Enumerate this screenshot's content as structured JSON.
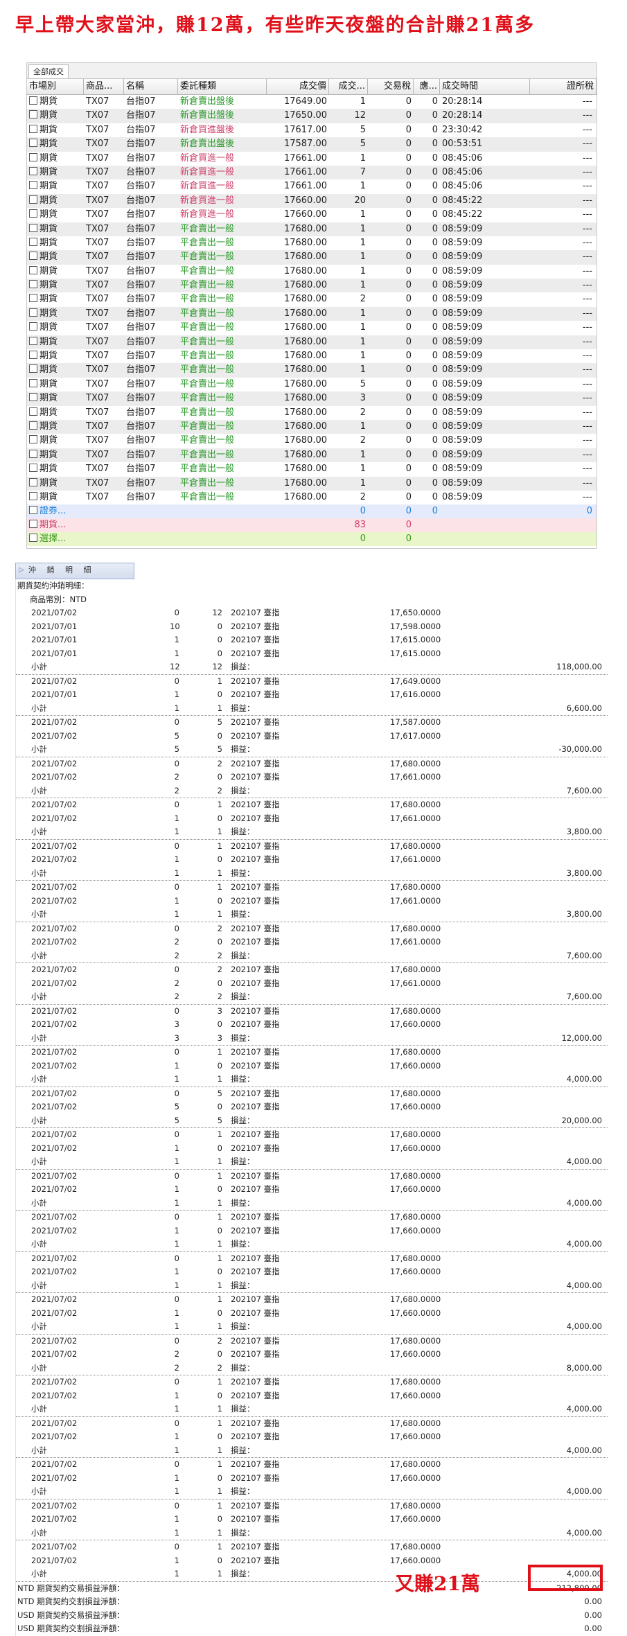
{
  "headline": "早上帶大家當沖，賺12萬，有些昨天夜盤的合計賺21萬多",
  "trades": {
    "tab_label": "全部成交",
    "columns": [
      "市場別",
      "商品...",
      "名稱",
      "委託種類",
      "成交價",
      "成交...",
      "交易稅",
      "應...",
      "成交時間",
      "證所稅"
    ],
    "rows": [
      {
        "market": "期貨",
        "code": "TX07",
        "name": "台指07",
        "type": "新倉賣出盤後",
        "price": "17649.00",
        "qty": "1",
        "tax": "0",
        "fee": "0",
        "time": "20:28:14",
        "stt": "---",
        "tone": "green"
      },
      {
        "market": "期貨",
        "code": "TX07",
        "name": "台指07",
        "type": "新倉賣出盤後",
        "price": "17650.00",
        "qty": "12",
        "tax": "0",
        "fee": "0",
        "time": "20:28:14",
        "stt": "---",
        "tone": "green"
      },
      {
        "market": "期貨",
        "code": "TX07",
        "name": "台指07",
        "type": "新倉買進盤後",
        "price": "17617.00",
        "qty": "5",
        "tax": "0",
        "fee": "0",
        "time": "23:30:42",
        "stt": "---",
        "tone": "red"
      },
      {
        "market": "期貨",
        "code": "TX07",
        "name": "台指07",
        "type": "新倉賣出盤後",
        "price": "17587.00",
        "qty": "5",
        "tax": "0",
        "fee": "0",
        "time": "00:53:51",
        "stt": "---",
        "tone": "green"
      },
      {
        "market": "期貨",
        "code": "TX07",
        "name": "台指07",
        "type": "新倉買進一般",
        "price": "17661.00",
        "qty": "1",
        "tax": "0",
        "fee": "0",
        "time": "08:45:06",
        "stt": "---",
        "tone": "red"
      },
      {
        "market": "期貨",
        "code": "TX07",
        "name": "台指07",
        "type": "新倉買進一般",
        "price": "17661.00",
        "qty": "7",
        "tax": "0",
        "fee": "0",
        "time": "08:45:06",
        "stt": "---",
        "tone": "red"
      },
      {
        "market": "期貨",
        "code": "TX07",
        "name": "台指07",
        "type": "新倉買進一般",
        "price": "17661.00",
        "qty": "1",
        "tax": "0",
        "fee": "0",
        "time": "08:45:06",
        "stt": "---",
        "tone": "red"
      },
      {
        "market": "期貨",
        "code": "TX07",
        "name": "台指07",
        "type": "新倉買進一般",
        "price": "17660.00",
        "qty": "20",
        "tax": "0",
        "fee": "0",
        "time": "08:45:22",
        "stt": "---",
        "tone": "red"
      },
      {
        "market": "期貨",
        "code": "TX07",
        "name": "台指07",
        "type": "新倉買進一般",
        "price": "17660.00",
        "qty": "1",
        "tax": "0",
        "fee": "0",
        "time": "08:45:22",
        "stt": "---",
        "tone": "red"
      },
      {
        "market": "期貨",
        "code": "TX07",
        "name": "台指07",
        "type": "平倉賣出一般",
        "price": "17680.00",
        "qty": "1",
        "tax": "0",
        "fee": "0",
        "time": "08:59:09",
        "stt": "---",
        "tone": "green"
      },
      {
        "market": "期貨",
        "code": "TX07",
        "name": "台指07",
        "type": "平倉賣出一般",
        "price": "17680.00",
        "qty": "1",
        "tax": "0",
        "fee": "0",
        "time": "08:59:09",
        "stt": "---",
        "tone": "green"
      },
      {
        "market": "期貨",
        "code": "TX07",
        "name": "台指07",
        "type": "平倉賣出一般",
        "price": "17680.00",
        "qty": "1",
        "tax": "0",
        "fee": "0",
        "time": "08:59:09",
        "stt": "---",
        "tone": "green"
      },
      {
        "market": "期貨",
        "code": "TX07",
        "name": "台指07",
        "type": "平倉賣出一般",
        "price": "17680.00",
        "qty": "1",
        "tax": "0",
        "fee": "0",
        "time": "08:59:09",
        "stt": "---",
        "tone": "green"
      },
      {
        "market": "期貨",
        "code": "TX07",
        "name": "台指07",
        "type": "平倉賣出一般",
        "price": "17680.00",
        "qty": "1",
        "tax": "0",
        "fee": "0",
        "time": "08:59:09",
        "stt": "---",
        "tone": "green"
      },
      {
        "market": "期貨",
        "code": "TX07",
        "name": "台指07",
        "type": "平倉賣出一般",
        "price": "17680.00",
        "qty": "2",
        "tax": "0",
        "fee": "0",
        "time": "08:59:09",
        "stt": "---",
        "tone": "green"
      },
      {
        "market": "期貨",
        "code": "TX07",
        "name": "台指07",
        "type": "平倉賣出一般",
        "price": "17680.00",
        "qty": "1",
        "tax": "0",
        "fee": "0",
        "time": "08:59:09",
        "stt": "---",
        "tone": "green"
      },
      {
        "market": "期貨",
        "code": "TX07",
        "name": "台指07",
        "type": "平倉賣出一般",
        "price": "17680.00",
        "qty": "1",
        "tax": "0",
        "fee": "0",
        "time": "08:59:09",
        "stt": "---",
        "tone": "green"
      },
      {
        "market": "期貨",
        "code": "TX07",
        "name": "台指07",
        "type": "平倉賣出一般",
        "price": "17680.00",
        "qty": "1",
        "tax": "0",
        "fee": "0",
        "time": "08:59:09",
        "stt": "---",
        "tone": "green"
      },
      {
        "market": "期貨",
        "code": "TX07",
        "name": "台指07",
        "type": "平倉賣出一般",
        "price": "17680.00",
        "qty": "1",
        "tax": "0",
        "fee": "0",
        "time": "08:59:09",
        "stt": "---",
        "tone": "green"
      },
      {
        "market": "期貨",
        "code": "TX07",
        "name": "台指07",
        "type": "平倉賣出一般",
        "price": "17680.00",
        "qty": "1",
        "tax": "0",
        "fee": "0",
        "time": "08:59:09",
        "stt": "---",
        "tone": "green"
      },
      {
        "market": "期貨",
        "code": "TX07",
        "name": "台指07",
        "type": "平倉賣出一般",
        "price": "17680.00",
        "qty": "5",
        "tax": "0",
        "fee": "0",
        "time": "08:59:09",
        "stt": "---",
        "tone": "green"
      },
      {
        "market": "期貨",
        "code": "TX07",
        "name": "台指07",
        "type": "平倉賣出一般",
        "price": "17680.00",
        "qty": "3",
        "tax": "0",
        "fee": "0",
        "time": "08:59:09",
        "stt": "---",
        "tone": "green"
      },
      {
        "market": "期貨",
        "code": "TX07",
        "name": "台指07",
        "type": "平倉賣出一般",
        "price": "17680.00",
        "qty": "2",
        "tax": "0",
        "fee": "0",
        "time": "08:59:09",
        "stt": "---",
        "tone": "green"
      },
      {
        "market": "期貨",
        "code": "TX07",
        "name": "台指07",
        "type": "平倉賣出一般",
        "price": "17680.00",
        "qty": "1",
        "tax": "0",
        "fee": "0",
        "time": "08:59:09",
        "stt": "---",
        "tone": "green"
      },
      {
        "market": "期貨",
        "code": "TX07",
        "name": "台指07",
        "type": "平倉賣出一般",
        "price": "17680.00",
        "qty": "2",
        "tax": "0",
        "fee": "0",
        "time": "08:59:09",
        "stt": "---",
        "tone": "green"
      },
      {
        "market": "期貨",
        "code": "TX07",
        "name": "台指07",
        "type": "平倉賣出一般",
        "price": "17680.00",
        "qty": "1",
        "tax": "0",
        "fee": "0",
        "time": "08:59:09",
        "stt": "---",
        "tone": "green"
      },
      {
        "market": "期貨",
        "code": "TX07",
        "name": "台指07",
        "type": "平倉賣出一般",
        "price": "17680.00",
        "qty": "1",
        "tax": "0",
        "fee": "0",
        "time": "08:59:09",
        "stt": "---",
        "tone": "green"
      },
      {
        "market": "期貨",
        "code": "TX07",
        "name": "台指07",
        "type": "平倉賣出一般",
        "price": "17680.00",
        "qty": "1",
        "tax": "0",
        "fee": "0",
        "time": "08:59:09",
        "stt": "---",
        "tone": "green"
      },
      {
        "market": "期貨",
        "code": "TX07",
        "name": "台指07",
        "type": "平倉賣出一般",
        "price": "17680.00",
        "qty": "2",
        "tax": "0",
        "fee": "0",
        "time": "08:59:09",
        "stt": "---",
        "tone": "green"
      }
    ],
    "summaries": [
      {
        "label": "證券...",
        "qty": "0",
        "tax": "0",
        "fee": "0",
        "stt": "0",
        "bg": "#e6ebfc",
        "color": "#1a7fd6"
      },
      {
        "label": "期貨...",
        "qty": "83",
        "tax": "0",
        "fee": "",
        "stt": "",
        "bg": "#fbe3e8",
        "color": "#d0406a"
      },
      {
        "label": "選擇...",
        "qty": "0",
        "tax": "0",
        "fee": "",
        "stt": "",
        "bg": "#e8f6c9",
        "color": "#3a9a1a"
      }
    ]
  },
  "statement": {
    "tab_label": "沖 銷 明 細",
    "header1": "期貨契約沖銷明細：",
    "header2": "商品幣別：NTD",
    "pl_label": "損益：",
    "subtotal_label": "小計",
    "contract": "202107 臺指",
    "groups": [
      {
        "lines": [
          [
            "2021/07/02",
            "0",
            "12",
            "17,650.0000"
          ],
          [
            "2021/07/01",
            "10",
            "0",
            "17,598.0000"
          ],
          [
            "2021/07/01",
            "1",
            "0",
            "17,615.0000"
          ],
          [
            "2021/07/01",
            "1",
            "0",
            "17,615.0000"
          ]
        ],
        "q1": "12",
        "q2": "12",
        "amount": "118,000.00"
      },
      {
        "lines": [
          [
            "2021/07/02",
            "0",
            "1",
            "17,649.0000"
          ],
          [
            "2021/07/01",
            "1",
            "0",
            "17,616.0000"
          ]
        ],
        "q1": "1",
        "q2": "1",
        "amount": "6,600.00"
      },
      {
        "lines": [
          [
            "2021/07/02",
            "0",
            "5",
            "17,587.0000"
          ],
          [
            "2021/07/02",
            "5",
            "0",
            "17,617.0000"
          ]
        ],
        "q1": "5",
        "q2": "5",
        "amount": "-30,000.00"
      },
      {
        "lines": [
          [
            "2021/07/02",
            "0",
            "2",
            "17,680.0000"
          ],
          [
            "2021/07/02",
            "2",
            "0",
            "17,661.0000"
          ]
        ],
        "q1": "2",
        "q2": "2",
        "amount": "7,600.00"
      },
      {
        "lines": [
          [
            "2021/07/02",
            "0",
            "1",
            "17,680.0000"
          ],
          [
            "2021/07/02",
            "1",
            "0",
            "17,661.0000"
          ]
        ],
        "q1": "1",
        "q2": "1",
        "amount": "3,800.00"
      },
      {
        "lines": [
          [
            "2021/07/02",
            "0",
            "1",
            "17,680.0000"
          ],
          [
            "2021/07/02",
            "1",
            "0",
            "17,661.0000"
          ]
        ],
        "q1": "1",
        "q2": "1",
        "amount": "3,800.00"
      },
      {
        "lines": [
          [
            "2021/07/02",
            "0",
            "1",
            "17,680.0000"
          ],
          [
            "2021/07/02",
            "1",
            "0",
            "17,661.0000"
          ]
        ],
        "q1": "1",
        "q2": "1",
        "amount": "3,800.00"
      },
      {
        "lines": [
          [
            "2021/07/02",
            "0",
            "2",
            "17,680.0000"
          ],
          [
            "2021/07/02",
            "2",
            "0",
            "17,661.0000"
          ]
        ],
        "q1": "2",
        "q2": "2",
        "amount": "7,600.00"
      },
      {
        "lines": [
          [
            "2021/07/02",
            "0",
            "2",
            "17,680.0000"
          ],
          [
            "2021/07/02",
            "2",
            "0",
            "17,661.0000"
          ]
        ],
        "q1": "2",
        "q2": "2",
        "amount": "7,600.00"
      },
      {
        "lines": [
          [
            "2021/07/02",
            "0",
            "3",
            "17,680.0000"
          ],
          [
            "2021/07/02",
            "3",
            "0",
            "17,660.0000"
          ]
        ],
        "q1": "3",
        "q2": "3",
        "amount": "12,000.00"
      },
      {
        "lines": [
          [
            "2021/07/02",
            "0",
            "1",
            "17,680.0000"
          ],
          [
            "2021/07/02",
            "1",
            "0",
            "17,660.0000"
          ]
        ],
        "q1": "1",
        "q2": "1",
        "amount": "4,000.00"
      },
      {
        "lines": [
          [
            "2021/07/02",
            "0",
            "5",
            "17,680.0000"
          ],
          [
            "2021/07/02",
            "5",
            "0",
            "17,660.0000"
          ]
        ],
        "q1": "5",
        "q2": "5",
        "amount": "20,000.00"
      },
      {
        "lines": [
          [
            "2021/07/02",
            "0",
            "1",
            "17,680.0000"
          ],
          [
            "2021/07/02",
            "1",
            "0",
            "17,660.0000"
          ]
        ],
        "q1": "1",
        "q2": "1",
        "amount": "4,000.00"
      },
      {
        "lines": [
          [
            "2021/07/02",
            "0",
            "1",
            "17,680.0000"
          ],
          [
            "2021/07/02",
            "1",
            "0",
            "17,660.0000"
          ]
        ],
        "q1": "1",
        "q2": "1",
        "amount": "4,000.00"
      },
      {
        "lines": [
          [
            "2021/07/02",
            "0",
            "1",
            "17,680.0000"
          ],
          [
            "2021/07/02",
            "1",
            "0",
            "17,660.0000"
          ]
        ],
        "q1": "1",
        "q2": "1",
        "amount": "4,000.00"
      },
      {
        "lines": [
          [
            "2021/07/02",
            "0",
            "1",
            "17,680.0000"
          ],
          [
            "2021/07/02",
            "1",
            "0",
            "17,660.0000"
          ]
        ],
        "q1": "1",
        "q2": "1",
        "amount": "4,000.00"
      },
      {
        "lines": [
          [
            "2021/07/02",
            "0",
            "1",
            "17,680.0000"
          ],
          [
            "2021/07/02",
            "1",
            "0",
            "17,660.0000"
          ]
        ],
        "q1": "1",
        "q2": "1",
        "amount": "4,000.00"
      },
      {
        "lines": [
          [
            "2021/07/02",
            "0",
            "2",
            "17,680.0000"
          ],
          [
            "2021/07/02",
            "2",
            "0",
            "17,660.0000"
          ]
        ],
        "q1": "2",
        "q2": "2",
        "amount": "8,000.00"
      },
      {
        "lines": [
          [
            "2021/07/02",
            "0",
            "1",
            "17,680.0000"
          ],
          [
            "2021/07/02",
            "1",
            "0",
            "17,660.0000"
          ]
        ],
        "q1": "1",
        "q2": "1",
        "amount": "4,000.00"
      },
      {
        "lines": [
          [
            "2021/07/02",
            "0",
            "1",
            "17,680.0000"
          ],
          [
            "2021/07/02",
            "1",
            "0",
            "17,660.0000"
          ]
        ],
        "q1": "1",
        "q2": "1",
        "amount": "4,000.00"
      },
      {
        "lines": [
          [
            "2021/07/02",
            "0",
            "1",
            "17,680.0000"
          ],
          [
            "2021/07/02",
            "1",
            "0",
            "17,660.0000"
          ]
        ],
        "q1": "1",
        "q2": "1",
        "amount": "4,000.00"
      },
      {
        "lines": [
          [
            "2021/07/02",
            "0",
            "1",
            "17,680.0000"
          ],
          [
            "2021/07/02",
            "1",
            "0",
            "17,660.0000"
          ]
        ],
        "q1": "1",
        "q2": "1",
        "amount": "4,000.00"
      },
      {
        "lines": [
          [
            "2021/07/02",
            "0",
            "1",
            "17,680.0000"
          ],
          [
            "2021/07/02",
            "1",
            "0",
            "17,660.0000"
          ]
        ],
        "q1": "1",
        "q2": "1",
        "amount": "4,000.00"
      }
    ],
    "totals": [
      {
        "label": "NTD 期貨契約交易損益淨額：",
        "amount": "212,800.00"
      },
      {
        "label": "NTD 期貨契約交割損益淨額：",
        "amount": "0.00"
      },
      {
        "label": "USD 期貨契約交易損益淨額：",
        "amount": "0.00"
      },
      {
        "label": "USD 期貨契約交割損益淨額：",
        "amount": "0.00"
      }
    ]
  },
  "annotation": "又賺21萬",
  "colors": {
    "accent_red": "#e0101a",
    "buy_red": "#d0406a",
    "sell_green": "#2a9a2a"
  }
}
